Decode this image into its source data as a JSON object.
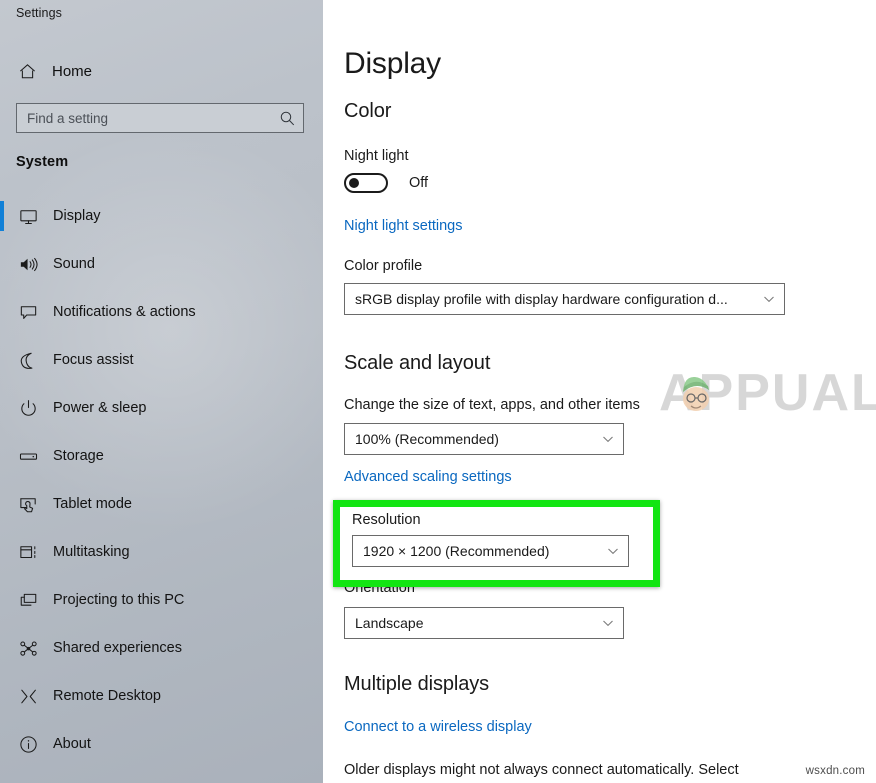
{
  "window": {
    "app_title": "Settings"
  },
  "sidebar": {
    "home_label": "Home",
    "home_icon": "home-icon",
    "search": {
      "placeholder": "Find a setting",
      "value": "",
      "icon": "search-icon"
    },
    "section_title": "System",
    "selected_index": 0,
    "accent_color": "#1180d7",
    "items": [
      {
        "label": "Display",
        "icon": "monitor-icon",
        "selected": true
      },
      {
        "label": "Sound",
        "icon": "speaker-icon",
        "selected": false
      },
      {
        "label": "Notifications & actions",
        "icon": "chat-bubble-icon",
        "selected": false
      },
      {
        "label": "Focus assist",
        "icon": "moon-icon",
        "selected": false
      },
      {
        "label": "Power & sleep",
        "icon": "power-icon",
        "selected": false
      },
      {
        "label": "Storage",
        "icon": "drive-icon",
        "selected": false
      },
      {
        "label": "Tablet mode",
        "icon": "tablet-touch-icon",
        "selected": false
      },
      {
        "label": "Multitasking",
        "icon": "multitasking-icon",
        "selected": false
      },
      {
        "label": "Projecting to this PC",
        "icon": "projecting-icon",
        "selected": false
      },
      {
        "label": "Shared experiences",
        "icon": "share-nodes-icon",
        "selected": false
      },
      {
        "label": "Remote Desktop",
        "icon": "remote-desktop-icon",
        "selected": false
      },
      {
        "label": "About",
        "icon": "info-icon",
        "selected": false
      }
    ]
  },
  "main": {
    "page_title": "Display",
    "color_section": {
      "title": "Color",
      "night_light_label": "Night light",
      "night_light_state": "Off",
      "night_light_on": false,
      "night_light_settings_link": "Night light settings",
      "color_profile_label": "Color profile",
      "color_profile_value": "sRGB display profile with display hardware configuration d..."
    },
    "scale_section": {
      "title": "Scale and layout",
      "scale_label": "Change the size of text, apps, and other items",
      "scale_value": "100% (Recommended)",
      "advanced_scaling_link": "Advanced scaling settings",
      "resolution_label": "Resolution",
      "resolution_value": "1920 × 1200 (Recommended)",
      "orientation_label": "Orientation",
      "orientation_value": "Landscape"
    },
    "multiple_displays_section": {
      "title": "Multiple displays",
      "wireless_link": "Connect to a wireless display",
      "description": "Older displays might not always connect automatically. Select"
    }
  },
  "annotation": {
    "highlight_color": "#13e513",
    "highlight_target": "Resolution"
  },
  "watermarks": {
    "center_text": "APPUALS",
    "corner_text": "wsxdn.com"
  }
}
